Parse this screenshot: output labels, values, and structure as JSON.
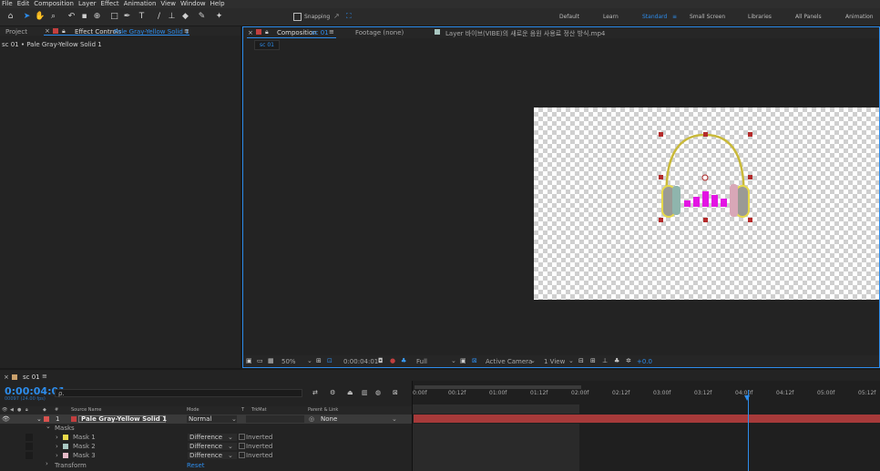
{
  "menu": [
    "File",
    "Edit",
    "Composition",
    "Layer",
    "Effect",
    "Animation",
    "View",
    "Window",
    "Help"
  ],
  "toolbar": {
    "snapping": "Snapping",
    "workspaces": [
      "Default",
      "Learn",
      "Standard",
      "Small Screen",
      "Libraries",
      "All Panels",
      "Animation"
    ],
    "active": "Standard"
  },
  "left_panel": {
    "tab_project": "Project",
    "tab_effect_prefix": "Effect Controls",
    "tab_effect_layer": "Pale Gray-Yellow Solid 1",
    "breadcrumb": "sc 01 • Pale Gray-Yellow Solid 1"
  },
  "comp_panel": {
    "tab_comp_prefix": "Composition",
    "tab_comp_name": "sc 01",
    "tab_footage": "Footage (none)",
    "tab_layer": "Layer 바이브(VIBE)의 새로운 음원 사용료 정산 방식.mp4",
    "subtab": "sc 01",
    "footer": {
      "zoom": "50%",
      "timecode": "0:00:04:01",
      "resolution": "Full",
      "camera": "Active Camera",
      "views": "1 View",
      "exposure": "+0.0"
    }
  },
  "timeline": {
    "tab": "sc 01",
    "timecode": "0:00:04:01",
    "fps": "00097 (24.00 fps)",
    "search_placeholder": "ρ.",
    "col_source": "Source Name",
    "col_mode": "Mode",
    "col_t": "T",
    "col_trkmat": "TrkMat",
    "col_parent": "Parent & Link",
    "layer": {
      "index": "1",
      "name": "Pale Gray-Yellow Solid 1",
      "mode": "Normal",
      "parent": "None",
      "color": "#d9534f"
    },
    "masks_label": "Masks",
    "masks": [
      {
        "name": "Mask 1",
        "color": "#e8d94a",
        "mode": "Difference",
        "inv": "Inverted"
      },
      {
        "name": "Mask 2",
        "color": "#a9c7c1",
        "mode": "Difference",
        "inv": "Inverted"
      },
      {
        "name": "Mask 3",
        "color": "#e4b9c6",
        "mode": "Difference",
        "inv": "Inverted"
      }
    ],
    "transform": "Transform",
    "reset": "Reset",
    "ruler": [
      "0:00f",
      "00:12f",
      "01:00f",
      "01:12f",
      "02:00f",
      "02:12f",
      "03:00f",
      "03:12f",
      "04:00f",
      "04:12f",
      "05:00f",
      "05:12f"
    ]
  }
}
